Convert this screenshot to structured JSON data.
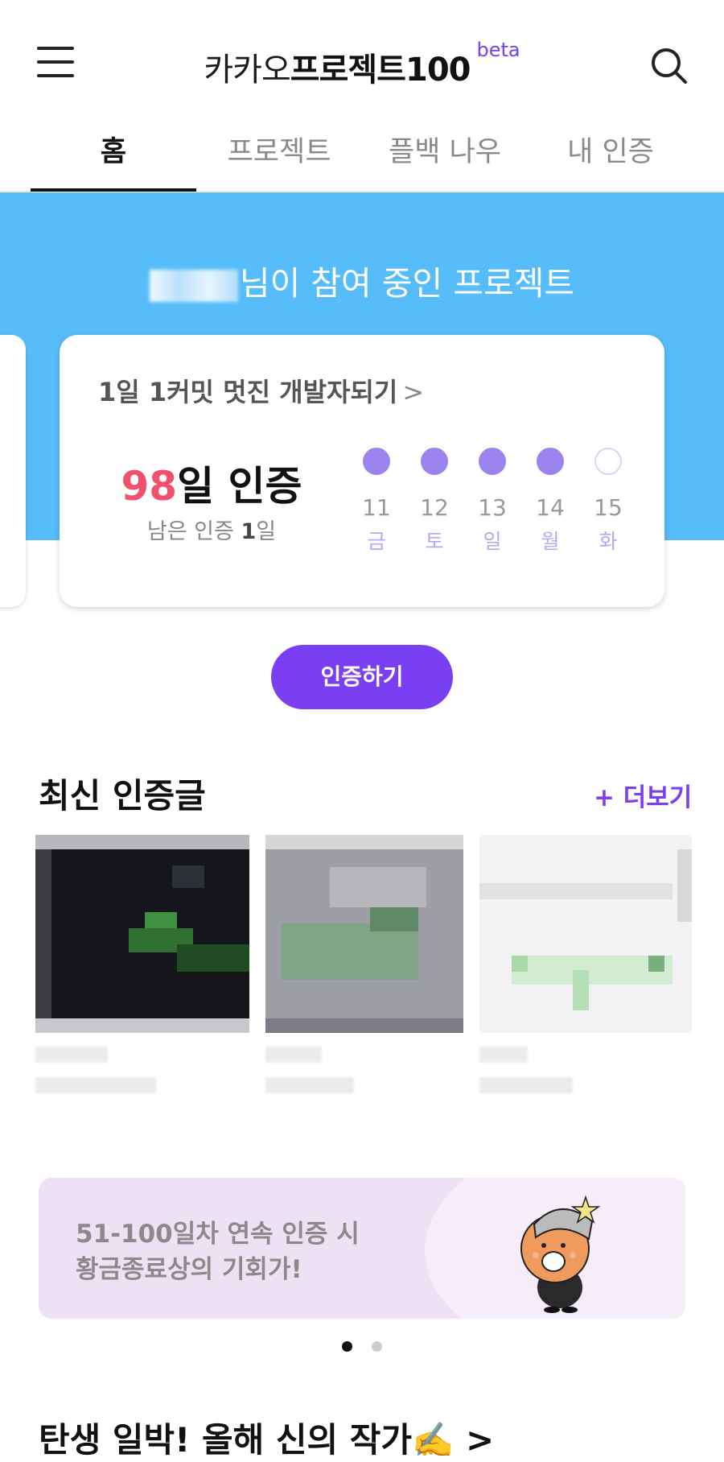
{
  "header": {
    "logo_light": "카카오",
    "logo_bold": "프로젝트100",
    "logo_beta": "beta"
  },
  "tabs": [
    {
      "label": "홈",
      "active": true
    },
    {
      "label": "프로젝트",
      "active": false
    },
    {
      "label": "플백 나우",
      "active": false
    },
    {
      "label": "내 인증",
      "active": false
    }
  ],
  "hero": {
    "title_suffix": "님이 참여 중인 프로젝트"
  },
  "project_card": {
    "title": "1일 1커밋 멋진 개발자되기",
    "chevron": ">",
    "days_count": "98",
    "days_suffix": "일 인증",
    "remaining_prefix": "남은 인증 ",
    "remaining_count": "1",
    "remaining_suffix": "일",
    "calendar": [
      {
        "date": "11",
        "weekday": "금",
        "done": true
      },
      {
        "date": "12",
        "weekday": "토",
        "done": true
      },
      {
        "date": "13",
        "weekday": "일",
        "done": true
      },
      {
        "date": "14",
        "weekday": "월",
        "done": true
      },
      {
        "date": "15",
        "weekday": "화",
        "done": false
      }
    ]
  },
  "cta": {
    "label": "인증하기"
  },
  "latest": {
    "title": "최신 인증글",
    "more_label": "+ 더보기"
  },
  "banner": {
    "line1": "51-100일차 연속 인증 시",
    "line2": "황금종료상의 기회가!"
  },
  "pager": {
    "total": 2,
    "active_index": 0
  },
  "bottom": {
    "title": "탄생 일박! 올해 신의 작가✍️ >"
  },
  "colors": {
    "accent": "#7a3ff2",
    "hero_bg": "#56bdfa",
    "done_dot": "#9a84ee",
    "count_highlight": "#f0506e"
  }
}
